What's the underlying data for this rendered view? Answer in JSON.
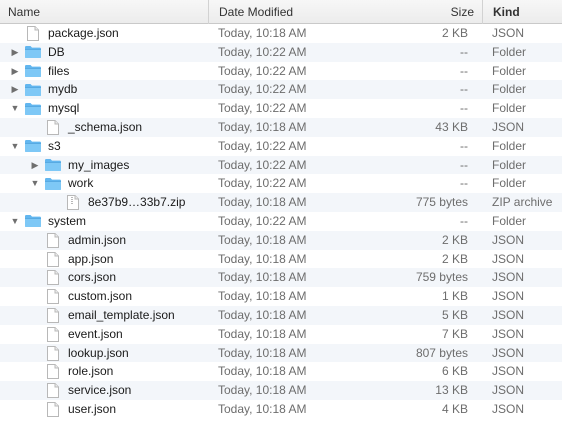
{
  "columns": {
    "name": "Name",
    "date": "Date Modified",
    "size": "Size",
    "kind": "Kind"
  },
  "rows": [
    {
      "name": "package.json",
      "date": "Today, 10:18 AM",
      "size": "2 KB",
      "kind": "JSON",
      "type": "file",
      "depth": 0
    },
    {
      "name": "DB",
      "date": "Today, 10:22 AM",
      "size": "--",
      "kind": "Folder",
      "type": "folder",
      "depth": 0,
      "expanded": false
    },
    {
      "name": "files",
      "date": "Today, 10:22 AM",
      "size": "--",
      "kind": "Folder",
      "type": "folder",
      "depth": 0,
      "expanded": false
    },
    {
      "name": "mydb",
      "date": "Today, 10:22 AM",
      "size": "--",
      "kind": "Folder",
      "type": "folder",
      "depth": 0,
      "expanded": false
    },
    {
      "name": "mysql",
      "date": "Today, 10:22 AM",
      "size": "--",
      "kind": "Folder",
      "type": "folder",
      "depth": 0,
      "expanded": true
    },
    {
      "name": "_schema.json",
      "date": "Today, 10:18 AM",
      "size": "43 KB",
      "kind": "JSON",
      "type": "file",
      "depth": 1
    },
    {
      "name": "s3",
      "date": "Today, 10:22 AM",
      "size": "--",
      "kind": "Folder",
      "type": "folder",
      "depth": 0,
      "expanded": true
    },
    {
      "name": "my_images",
      "date": "Today, 10:22 AM",
      "size": "--",
      "kind": "Folder",
      "type": "folder",
      "depth": 1,
      "expanded": false
    },
    {
      "name": "work",
      "date": "Today, 10:22 AM",
      "size": "--",
      "kind": "Folder",
      "type": "folder",
      "depth": 1,
      "expanded": true
    },
    {
      "name": "8e37b9…33b7.zip",
      "date": "Today, 10:18 AM",
      "size": "775 bytes",
      "kind": "ZIP archive",
      "type": "file",
      "depth": 2
    },
    {
      "name": "system",
      "date": "Today, 10:22 AM",
      "size": "--",
      "kind": "Folder",
      "type": "folder",
      "depth": 0,
      "expanded": true
    },
    {
      "name": "admin.json",
      "date": "Today, 10:18 AM",
      "size": "2 KB",
      "kind": "JSON",
      "type": "file",
      "depth": 1
    },
    {
      "name": "app.json",
      "date": "Today, 10:18 AM",
      "size": "2 KB",
      "kind": "JSON",
      "type": "file",
      "depth": 1
    },
    {
      "name": "cors.json",
      "date": "Today, 10:18 AM",
      "size": "759 bytes",
      "kind": "JSON",
      "type": "file",
      "depth": 1
    },
    {
      "name": "custom.json",
      "date": "Today, 10:18 AM",
      "size": "1 KB",
      "kind": "JSON",
      "type": "file",
      "depth": 1
    },
    {
      "name": "email_template.json",
      "date": "Today, 10:18 AM",
      "size": "5 KB",
      "kind": "JSON",
      "type": "file",
      "depth": 1
    },
    {
      "name": "event.json",
      "date": "Today, 10:18 AM",
      "size": "7 KB",
      "kind": "JSON",
      "type": "file",
      "depth": 1
    },
    {
      "name": "lookup.json",
      "date": "Today, 10:18 AM",
      "size": "807 bytes",
      "kind": "JSON",
      "type": "file",
      "depth": 1
    },
    {
      "name": "role.json",
      "date": "Today, 10:18 AM",
      "size": "6 KB",
      "kind": "JSON",
      "type": "file",
      "depth": 1
    },
    {
      "name": "service.json",
      "date": "Today, 10:18 AM",
      "size": "13 KB",
      "kind": "JSON",
      "type": "file",
      "depth": 1
    },
    {
      "name": "user.json",
      "date": "Today, 10:18 AM",
      "size": "4 KB",
      "kind": "JSON",
      "type": "file",
      "depth": 1
    }
  ],
  "colors": {
    "folder": "#62b6ef",
    "stripe": "#f3f6fa"
  }
}
